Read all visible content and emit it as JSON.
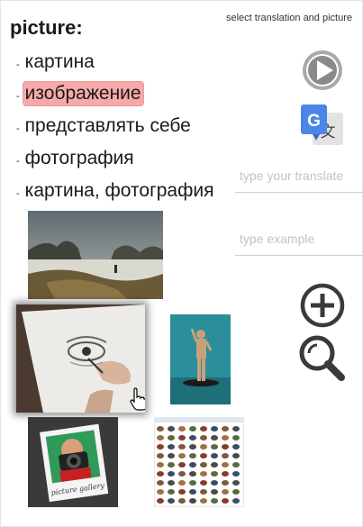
{
  "word": "picture:",
  "hint": "select translation and picture",
  "translations": [
    {
      "text": "картина",
      "selected": false
    },
    {
      "text": "изображение",
      "selected": true
    },
    {
      "text": "представлять себе",
      "selected": false
    },
    {
      "text": "фотография",
      "selected": false
    },
    {
      "text": "картина, фотография",
      "selected": false
    }
  ],
  "translation_input": {
    "placeholder": "type your translate",
    "value": ""
  },
  "example_input": {
    "placeholder": "type example",
    "value": ""
  },
  "icons": {
    "play": "play-icon",
    "translate": "google-translate-icon",
    "add": "plus-circle-icon",
    "search": "magnifier-icon"
  },
  "pictures": [
    {
      "name": "winter-landscape"
    },
    {
      "name": "drawing-hand"
    },
    {
      "name": "man-figure"
    },
    {
      "name": "picture-gallery-photographer"
    },
    {
      "name": "animals-grid"
    }
  ],
  "picture_gallery_caption": "picture gallery",
  "colors": {
    "selected_highlight": "#f6a9a9",
    "google_blue": "#4a86e8"
  }
}
